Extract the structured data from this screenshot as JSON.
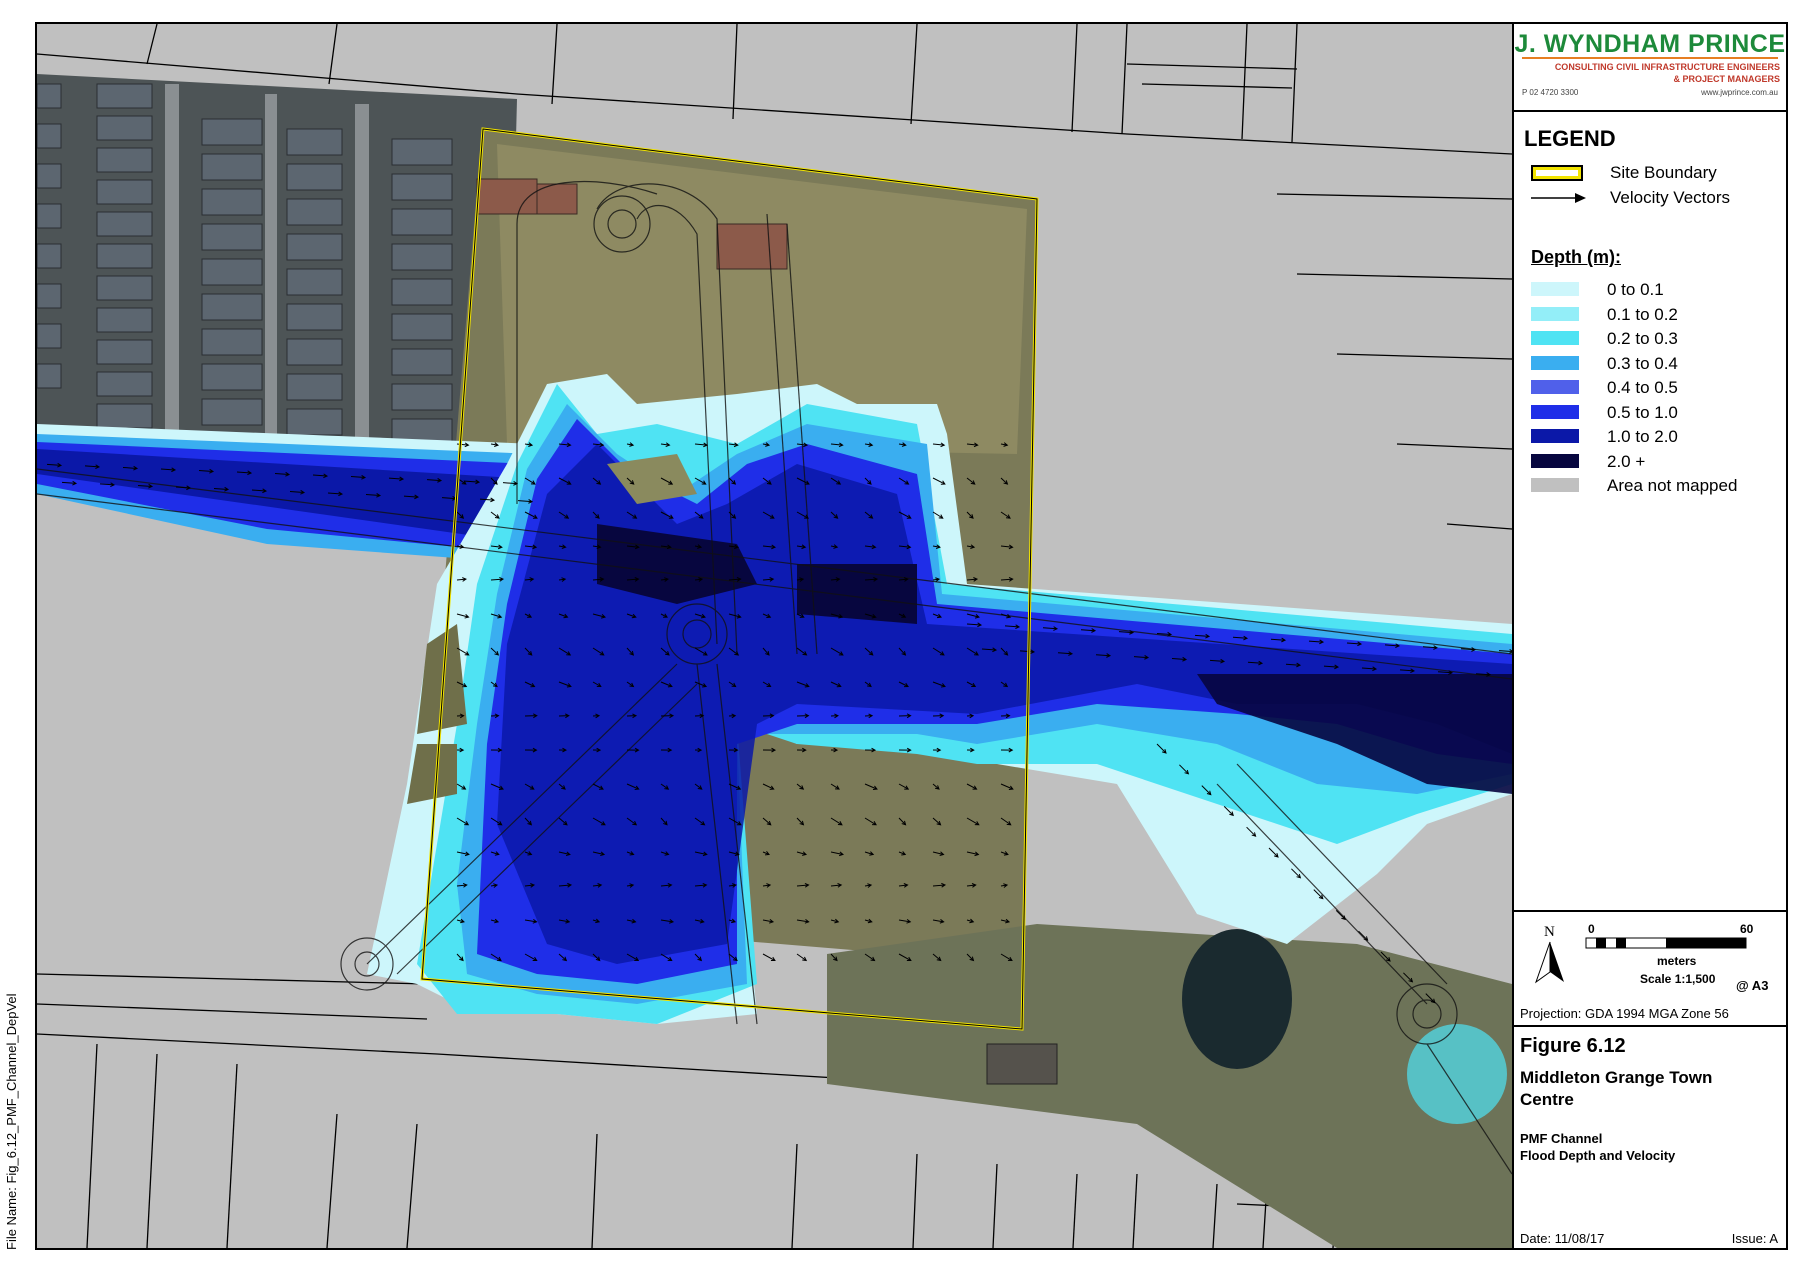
{
  "file_name": "File Name: Fig_6.12_PMF_Channel_DepVel",
  "logo": {
    "brand": "J. WYNDHAM PRINCE",
    "line1": "CONSULTING CIVIL INFRASTRUCTURE ENGINEERS",
    "line2": "& PROJECT MANAGERS",
    "phone": "P 02 4720 3300",
    "web": "www.jwprince.com.au",
    "brand_color": "#1d8a3a",
    "accent_color": "#c0392b"
  },
  "legend": {
    "heading": "LEGEND",
    "site_boundary": "Site Boundary",
    "velocity_vectors": "Velocity Vectors",
    "depth_title": "Depth (m):",
    "depth_classes": [
      {
        "label": "0 to 0.1",
        "color": "#cdf6fb"
      },
      {
        "label": "0.1 to 0.2",
        "color": "#93eef8"
      },
      {
        "label": "0.2 to 0.3",
        "color": "#4fe3f3"
      },
      {
        "label": "0.3 to 0.4",
        "color": "#3aaef0"
      },
      {
        "label": "0.4 to 0.5",
        "color": "#5060ea"
      },
      {
        "label": "0.5 to 1.0",
        "color": "#1f2ee8"
      },
      {
        "label": "1.0 to 2.0",
        "color": "#0b18a8"
      },
      {
        "label": "2.0 +",
        "color": "#07063f"
      },
      {
        "label": "Area not mapped",
        "color": "#c0c0c0"
      }
    ],
    "site_boundary_color": "#f2e400"
  },
  "scale": {
    "zero": "0",
    "max": "60",
    "units": "meters",
    "ratio": "Scale 1:1,500",
    "paper": "@ A3",
    "north": "N"
  },
  "projection": "Projection: GDA 1994 MGA Zone 56",
  "figure": {
    "number": "Figure 6.12",
    "title": "Middleton Grange Town Centre",
    "subtitle1": "PMF Channel",
    "subtitle2": "Flood Depth and Velocity",
    "date": "Date: 11/08/17",
    "issue": "Issue: A"
  }
}
